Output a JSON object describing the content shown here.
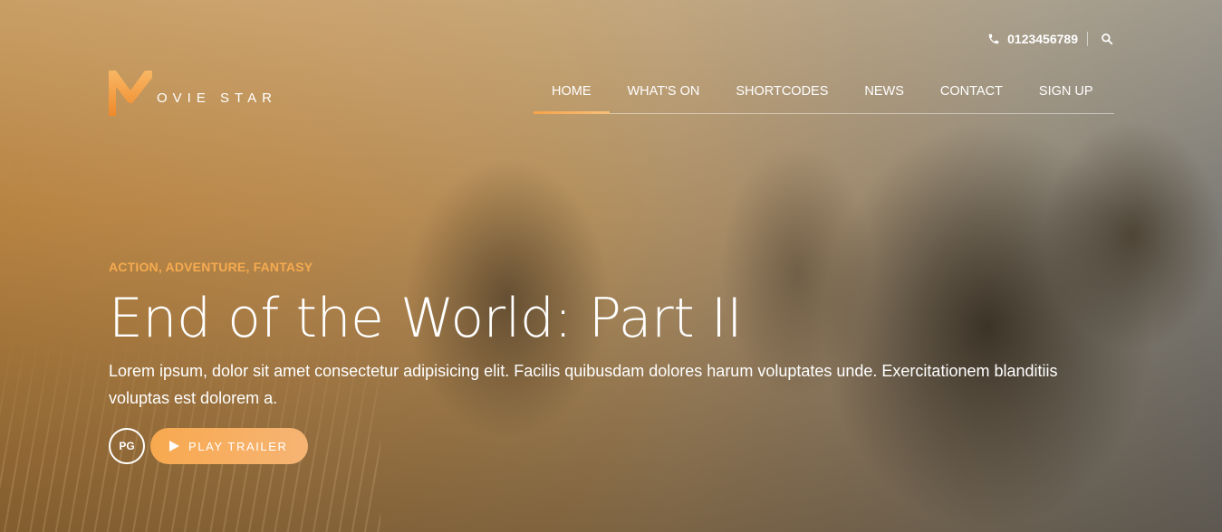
{
  "colors": {
    "accent": "#f6ab4f",
    "accent_light": "#f7c07a"
  },
  "topbar": {
    "phone_icon": "phone-icon",
    "phone": "0123456789",
    "search_icon": "search-icon"
  },
  "logo": {
    "letter": "M",
    "text": "OVIE STAR"
  },
  "nav": {
    "items": [
      {
        "label": "HOME",
        "active": true
      },
      {
        "label": "WHAT'S ON"
      },
      {
        "label": "SHORTCODES"
      },
      {
        "label": "NEWS"
      },
      {
        "label": "CONTACT"
      },
      {
        "label": "SIGN UP"
      }
    ]
  },
  "hero": {
    "genres": "ACTION, ADVENTURE, FANTASY",
    "title": "End of the World: Part II",
    "description": "Lorem ipsum, dolor sit amet consectetur adipisicing elit. Facilis quibusdam dolores harum voluptates unde. Exercitationem blanditiis voluptas est dolorem a.",
    "rating": "PG",
    "trailer_label": "PLAY TRAILER",
    "trailer_icon": "play-icon"
  }
}
